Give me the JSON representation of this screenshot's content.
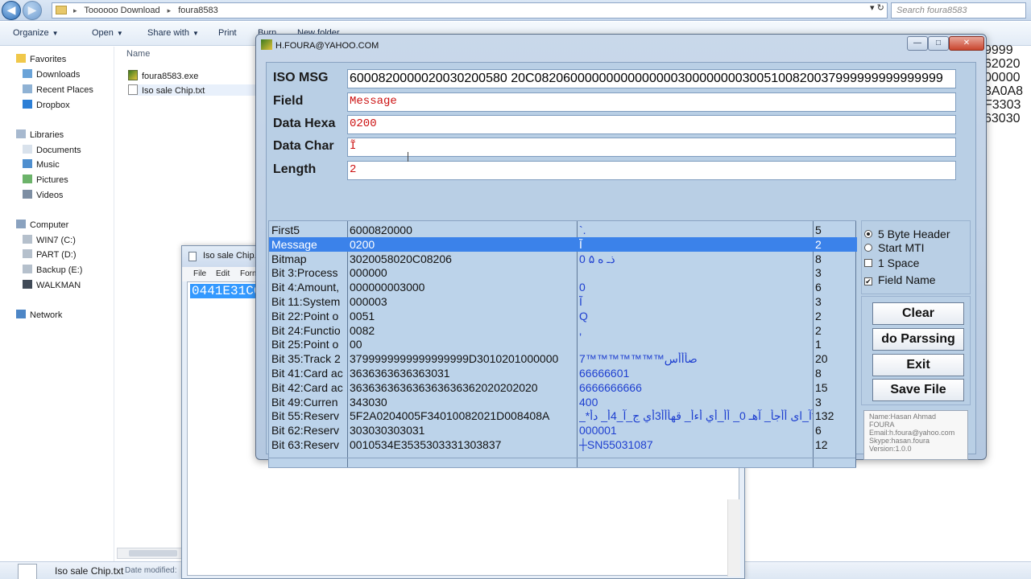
{
  "explorer": {
    "crumbs": [
      "Toooooo Download",
      "foura8583"
    ],
    "search_placeholder": "Search foura8583",
    "toolbar": {
      "organize": "Organize",
      "open": "Open",
      "share": "Share with",
      "print": "Print",
      "burn": "Burn",
      "new_folder": "New folder"
    },
    "nav": {
      "favorites": "Favorites",
      "fav_items": [
        "Downloads",
        "Recent Places",
        "Dropbox"
      ],
      "libraries": "Libraries",
      "lib_items": [
        "Documents",
        "Music",
        "Pictures",
        "Videos"
      ],
      "computer": "Computer",
      "drives": [
        "WIN7 (C:)",
        "PART (D:)",
        "Backup (E:)",
        "WALKMAN"
      ],
      "network": "Network"
    },
    "list_header": "Name",
    "files": [
      "foura8583.exe",
      "Iso sale Chip.txt"
    ],
    "status": {
      "name": "Iso sale Chip.txt",
      "modified_label": "Date modified:"
    }
  },
  "notepad": {
    "title": "Iso sale Chip.txt",
    "menu": [
      "File",
      "Edit",
      "Form"
    ],
    "selected_text": "0441E31C0"
  },
  "background_digits": "9999\n62020\n00000\n3A0A8\nF3303\n63030",
  "app": {
    "title": "H.FOURA@YAHOO.COM",
    "window_buttons": {
      "min": "—",
      "max": "□",
      "close": "✕"
    },
    "fields": {
      "iso_msg_label": "ISO MSG",
      "iso_msg_value": "6000820000020030200580 20C082060000000000000003000000003005100820037999999999999999",
      "field_label": "Field",
      "field_value": "Message",
      "data_hexa_label": "Data Hexa",
      "data_hexa_value": "0200",
      "data_char_label": "Data Char",
      "data_char_value": "Ĩ",
      "length_label": "Length",
      "length_value": "2"
    },
    "table": [
      [
        "First5",
        "6000820000",
        "`.",
        "5"
      ],
      [
        "Message",
        "0200",
        "Ĩ",
        "2"
      ],
      [
        "Bitmap",
        "3020058020C08206",
        "0 ذـ ه ۵",
        "8"
      ],
      [
        "Bit 3:Process",
        "000000",
        "",
        "3"
      ],
      [
        "Bit 4:Amount,",
        "000000003000",
        "0",
        "6"
      ],
      [
        "Bit 11:System",
        "000003",
        "Ĩ",
        "3"
      ],
      [
        "Bit 22:Point o",
        "0051",
        "Q",
        "2"
      ],
      [
        "Bit 24:Functio",
        "0082",
        "‚",
        "2"
      ],
      [
        "Bit 25:Point o",
        "00",
        "",
        "1"
      ],
      [
        "Bit 35:Track 2",
        "3799999999999999999D3010201000000",
        "7™™™™™™™صأأأس",
        "20"
      ],
      [
        "Bit 41:Card ac",
        "3636363636363031",
        "66666601",
        "8"
      ],
      [
        "Bit 42:Card ac",
        "363636363636363636362020202020",
        "6666666666",
        "15"
      ],
      [
        "Bit 49:Curren",
        "343030",
        "400",
        "3"
      ],
      [
        "Bit 55:Reserv",
        "5F2A0204005F34010082021D008408A",
        "_*آ_ای أأجأ_ آهـ 0_ أأ_أي أءأ_ قهأأأ3أي ج_آ_4أ_ دأ*",
        "132"
      ],
      [
        "Bit 62:Reserv",
        "303030303031",
        "000001",
        "6"
      ],
      [
        "Bit 63:Reserv",
        "0010534E3535303331303837",
        "┼SN55031087",
        "12"
      ]
    ],
    "selected_row": 1,
    "options": {
      "header5": "5 Byte Header",
      "start_mti": "Start MTI",
      "one_space": "1 Space",
      "field_name": "Field Name"
    },
    "buttons": {
      "clear": "Clear",
      "parse": "do Parssing",
      "exit": "Exit",
      "save": "Save File"
    },
    "info": [
      "Name:Hasan Ahmad",
      "FOURA",
      "Email:h.foura@yahoo.com",
      "Skype:hasan.foura",
      "Version:1.0.0"
    ]
  }
}
